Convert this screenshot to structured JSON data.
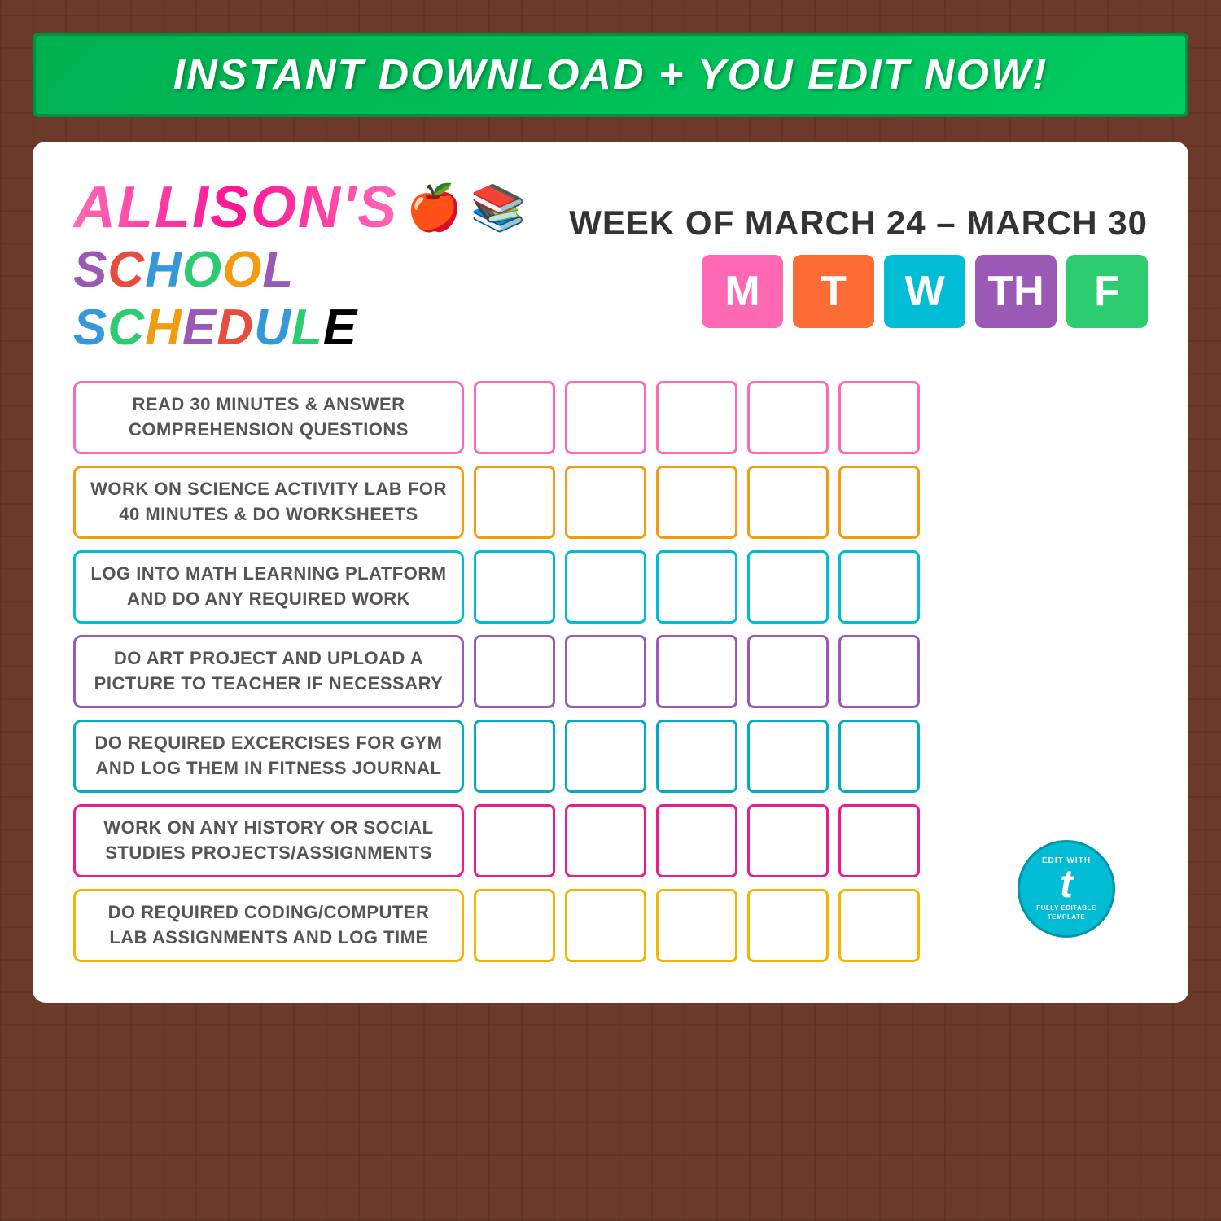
{
  "banner": {
    "text": "INSTANT DOWNLOAD + YOU EDIT NOW!"
  },
  "header": {
    "name": "ALLISON'S",
    "subtitle_school": "SCHOOL SCHEDULE",
    "week_of": "WEEK OF MARCH 24 – MARCH 30",
    "days": [
      "M",
      "T",
      "W",
      "TH",
      "F"
    ]
  },
  "tasks": [
    {
      "id": 1,
      "label": "READ 30 MINUTES & ANSWER COMPREHENSION QUESTIONS",
      "color": "pink",
      "check_color": "check-pink"
    },
    {
      "id": 2,
      "label": "WORK ON SCIENCE ACTIVITY LAB FOR 40 MINUTES & DO WORKSHEETS",
      "color": "orange",
      "check_color": "check-orange"
    },
    {
      "id": 3,
      "label": "LOG INTO MATH LEARNING PLATFORM AND DO ANY REQUIRED WORK",
      "color": "teal",
      "check_color": "check-teal"
    },
    {
      "id": 4,
      "label": "DO ART PROJECT AND UPLOAD A PICTURE TO TEACHER IF NECESSARY",
      "color": "purple",
      "check_color": "check-purple"
    },
    {
      "id": 5,
      "label": "DO REQUIRED EXCERCISES FOR GYM AND LOG THEM IN FITNESS JOURNAL",
      "color": "cyan",
      "check_color": "check-cyan"
    },
    {
      "id": 6,
      "label": "WORK ON ANY HISTORY OR SOCIAL STUDIES PROJECTS/ASSIGNMENTS",
      "color": "hotpink",
      "check_color": "check-hotpink"
    },
    {
      "id": 7,
      "label": "DO REQUIRED CODING/COMPUTER LAB ASSIGNMENTS AND LOG TIME",
      "color": "gold",
      "check_color": "check-gold"
    }
  ],
  "badge": {
    "line1": "EDIT WITH",
    "brand": "t",
    "line2": "FULLY EDITABLE TEMPLATE"
  }
}
